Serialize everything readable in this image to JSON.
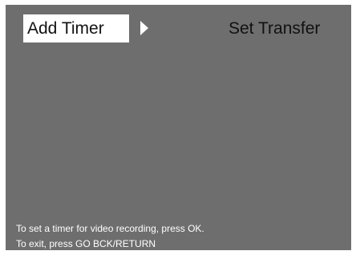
{
  "menu": {
    "items": [
      {
        "label": "Add Timer",
        "selected": true
      },
      {
        "label": "Set Transfer",
        "selected": false
      }
    ],
    "next_indicator_icon": "right-triangle-icon"
  },
  "help": {
    "line1": "To set a timer for video recording, press OK.",
    "line2": "To exit, press GO BCK/RETURN"
  },
  "colors": {
    "background": "#6e6e6e",
    "selection": "#ffffff",
    "text_dark": "#111111",
    "text_light": "#ffffff"
  }
}
